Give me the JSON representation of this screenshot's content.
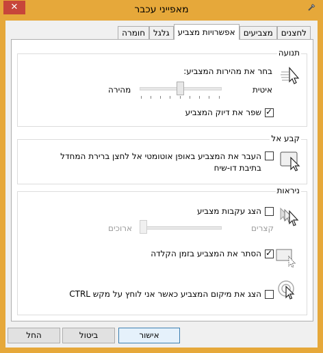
{
  "window": {
    "title": "מאפייני עכבר",
    "close_glyph": "✕"
  },
  "tabs": [
    {
      "label": "לחצנים"
    },
    {
      "label": "מצביעים"
    },
    {
      "label": "אפשרויות מצביע"
    },
    {
      "label": "גלגל"
    },
    {
      "label": "חומרה"
    }
  ],
  "motion": {
    "legend": "תנועה",
    "speed_label": "בחר את מהירות המצביע:",
    "slow_label": "איטית",
    "fast_label": "מהירה",
    "speed_level": 0.5,
    "precision_label": "שפר את דיוק המצביע",
    "precision_checked": true,
    "icon": "pointer-speed-icon"
  },
  "snap": {
    "legend": "קבע אל",
    "label": "העבר את המצביע באופן אוטומטי אל לחצן ברירת המחדל בתיבת דו-שיח",
    "checked": false,
    "icon": "snap-to-icon"
  },
  "visibility": {
    "legend": "ניראות",
    "trails_label": "הצג עקבות מצביע",
    "trails_checked": false,
    "short_label": "קצרים",
    "long_label": "ארוכים",
    "trails_level": 0,
    "hide_label": "הסתר את המצביע בזמן הקלדה",
    "hide_checked": true,
    "ctrl_label": "הצג את מיקום המצביע כאשר אני לוחץ על מקש CTRL",
    "ctrl_checked": false
  },
  "buttons": {
    "ok": "אישור",
    "cancel": "ביטול",
    "apply": "החל"
  }
}
